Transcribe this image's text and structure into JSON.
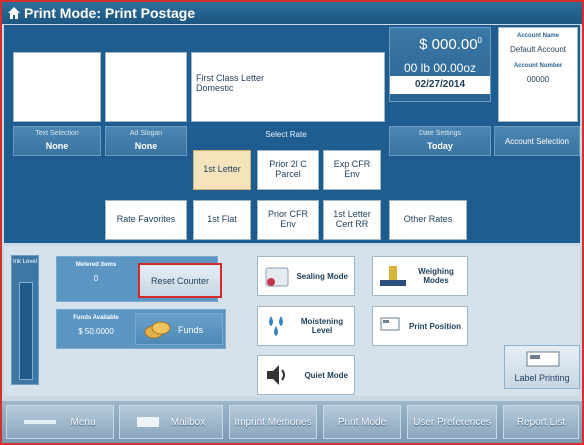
{
  "window": {
    "title": "Print Mode: Print Postage"
  },
  "selection": {
    "text_caption": "Text Selection",
    "text_value": "None",
    "ad_caption": "Ad Slogan",
    "ad_value": "None"
  },
  "mail_class": {
    "line1": "First Class Letter",
    "line2": "Domestic"
  },
  "postage": {
    "amount": "$ 000.00",
    "amount_sup": "0",
    "weight": "00 lb 00.00oz",
    "date": "02/27/2014",
    "date_caption": "Date Settings",
    "date_value": "Today"
  },
  "account": {
    "name_caption": "Account Name",
    "name": "Default Account",
    "number_caption": "Account Number",
    "number": "00000",
    "select_label": "Account Selection"
  },
  "rates": {
    "label": "Select Rate",
    "row1": [
      "1st Letter",
      "Prior 2l C Parcel",
      "Exp CFR Env"
    ],
    "favorites": "Rate Favorites",
    "row2": [
      "1st Flat",
      "Prior CFR Env",
      "1st Letter Cert RR"
    ],
    "other": "Other Rates"
  },
  "lower": {
    "ink_caption": "Ink Level",
    "metered_caption": "Metered items",
    "metered_value": "0",
    "reset": "Reset Counter",
    "funds_caption": "Funds Available",
    "funds_value": "$ 50.0000",
    "funds_button": "Funds",
    "sealing": "Sealing Mode",
    "weighing": "Weighing Modes",
    "moistening": "Moistening Level",
    "print_position": "Print Position",
    "quiet": "Quiet Mode",
    "label_printing": "Label Printing"
  },
  "nav": [
    "Menu",
    "Mailbox",
    "Imprint Memories",
    "Print Mode",
    "User Preferences",
    "Report List"
  ]
}
